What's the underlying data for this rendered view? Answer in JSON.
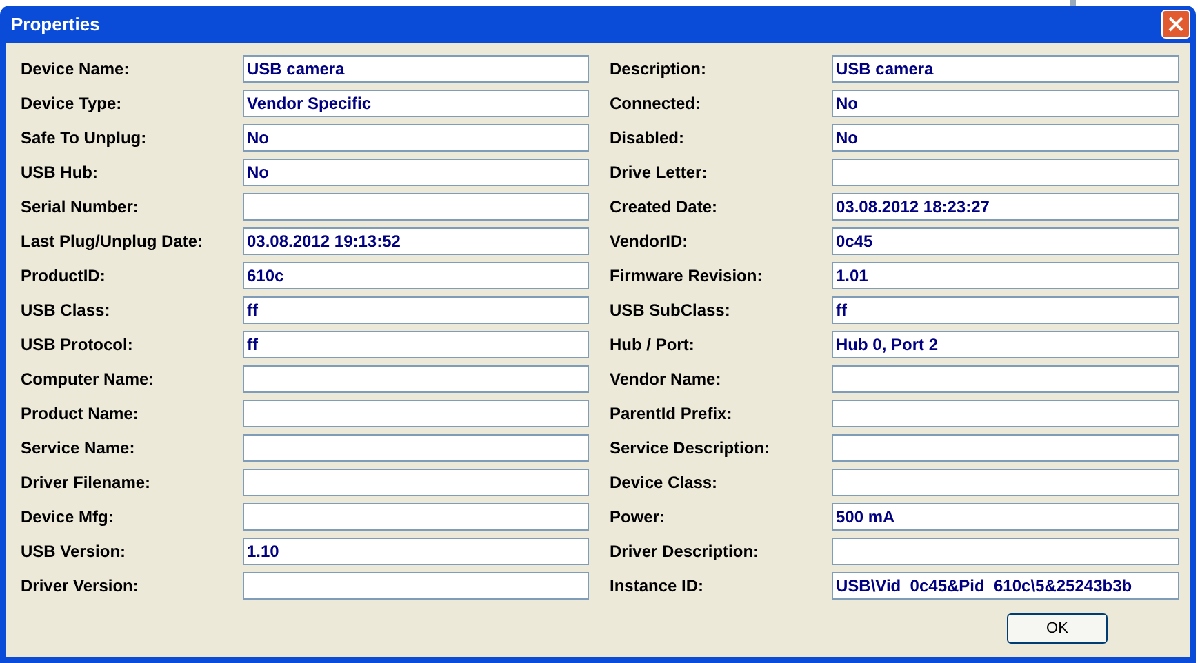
{
  "window": {
    "title": "Properties"
  },
  "fields": [
    {
      "label": "Device Name:",
      "value": "USB camera"
    },
    {
      "label": "Description:",
      "value": "USB camera"
    },
    {
      "label": "Device Type:",
      "value": "Vendor Specific"
    },
    {
      "label": "Connected:",
      "value": "No"
    },
    {
      "label": "Safe To Unplug:",
      "value": "No"
    },
    {
      "label": "Disabled:",
      "value": "No"
    },
    {
      "label": "USB Hub:",
      "value": "No"
    },
    {
      "label": "Drive Letter:"
    },
    {
      "label": "Serial Number:"
    },
    {
      "label": "Created Date:",
      "value": "03.08.2012 18:23:27"
    },
    {
      "label": "Last Plug/Unplug Date:",
      "value": "03.08.2012 19:13:52"
    },
    {
      "label": "VendorID:",
      "value": "0c45"
    },
    {
      "label": "ProductID:",
      "value": "610c"
    },
    {
      "label": "Firmware Revision:",
      "value": "1.01"
    },
    {
      "label": "USB Class:",
      "value": "ff"
    },
    {
      "label": "USB SubClass:",
      "value": "ff"
    },
    {
      "label": "USB Protocol:",
      "value": "ff"
    },
    {
      "label": "Hub / Port:",
      "value": "Hub 0, Port 2"
    },
    {
      "label": "Computer Name:"
    },
    {
      "label": "Vendor Name:"
    },
    {
      "label": "Product Name:"
    },
    {
      "label": "ParentId Prefix:"
    },
    {
      "label": "Service Name:"
    },
    {
      "label": "Service Description:"
    },
    {
      "label": "Driver Filename:"
    },
    {
      "label": "Device Class:"
    },
    {
      "label": "Device Mfg:"
    },
    {
      "label": "Power:",
      "value": "500 mA"
    },
    {
      "label": "USB Version:",
      "value": "1.10"
    },
    {
      "label": "Driver Description:"
    },
    {
      "label": "Driver Version:"
    },
    {
      "label": "Instance ID:",
      "value": "USB\\Vid_0c45&Pid_610c\\5&25243b3b"
    }
  ],
  "buttons": [
    "OK"
  ]
}
